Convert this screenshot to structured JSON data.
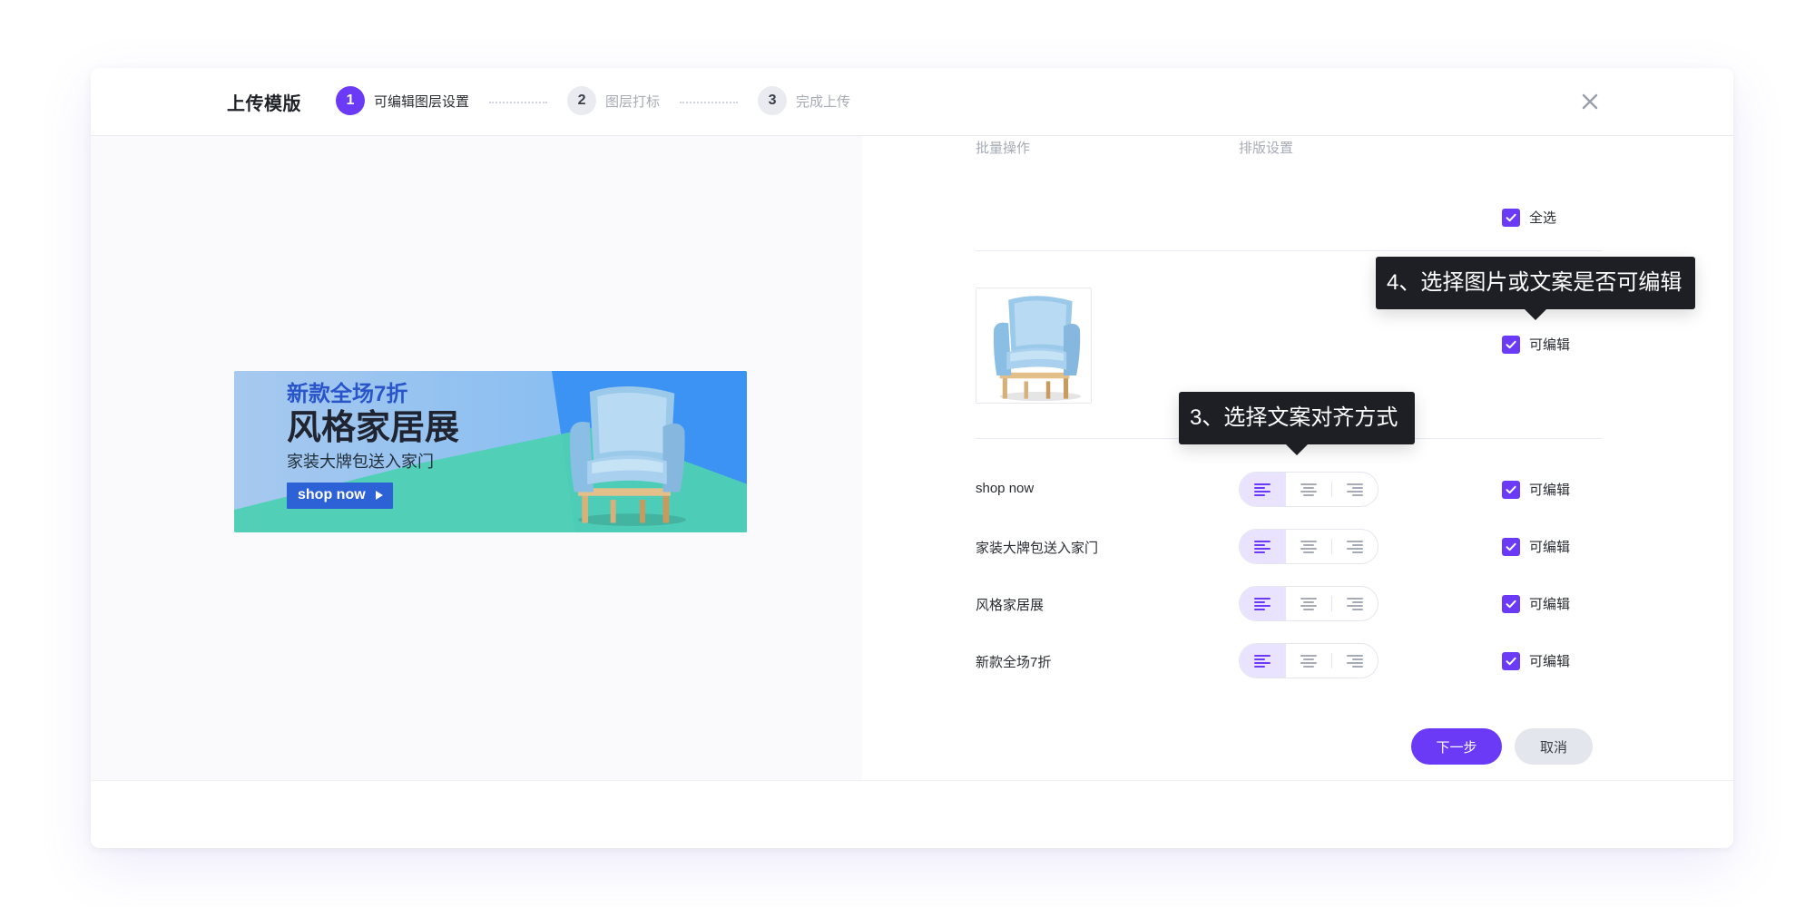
{
  "colors": {
    "accent": "#6B3AF6",
    "accent_weak": "#E9E3FF",
    "muted": "#A6ABB6",
    "tooltip_bg": "#1E1F24",
    "cancel_bg": "#E3E6ED"
  },
  "header": {
    "title": "上传模版",
    "steps": [
      {
        "number": "1",
        "label": "可编辑图层设置",
        "active": true
      },
      {
        "number": "2",
        "label": "图层打标",
        "active": false
      },
      {
        "number": "3",
        "label": "完成上传",
        "active": false
      }
    ],
    "close_icon": "close-icon"
  },
  "preview": {
    "banner": {
      "sale_text": "新款全场7折",
      "main_text": "风格家居展",
      "sub_text": "家装大牌包送入家门",
      "cta_text": "shop now",
      "cta_icon": "play-triangle-icon"
    }
  },
  "right_panel": {
    "labels": {
      "batch": "批量操作",
      "layout": "排版设置",
      "select_all": "全选"
    },
    "image_row": {
      "checkbox_label": "可编辑"
    },
    "text_rows": [
      {
        "text": "shop now",
        "checkbox_label": "可编辑",
        "align": "left"
      },
      {
        "text": "家装大牌包送入家门",
        "checkbox_label": "可编辑",
        "align": "left"
      },
      {
        "text": "风格家居展",
        "checkbox_label": "可编辑",
        "align": "left"
      },
      {
        "text": "新款全场7折",
        "checkbox_label": "可编辑",
        "align": "left"
      }
    ],
    "tooltips": {
      "align_tip": "3、选择文案对齐方式",
      "editable_tip": "4、选择图片或文案是否可编辑"
    },
    "icons": {
      "align_left": "align-left-icon",
      "align_center": "align-center-icon",
      "align_right": "align-right-icon",
      "checkbox_checked": "checkbox-checked-icon"
    }
  },
  "footer": {
    "next": "下一步",
    "cancel": "取消"
  }
}
